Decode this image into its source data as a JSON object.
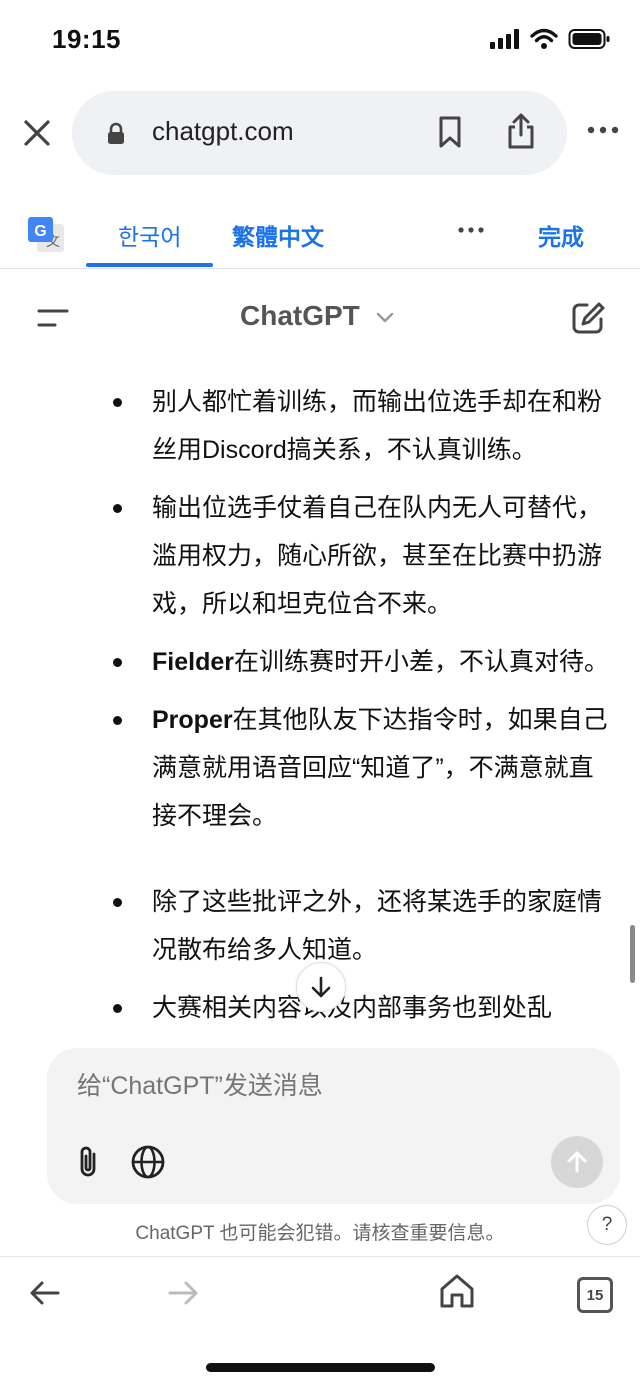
{
  "status_bar": {
    "time": "19:15"
  },
  "address_bar": {
    "url": "chatgpt.com"
  },
  "translate_bar": {
    "languages": [
      "한국어",
      "繁體中文"
    ],
    "done_label": "完成"
  },
  "chat_header": {
    "title": "ChatGPT"
  },
  "messages": [
    {
      "bold": "",
      "text": "别人都忙着训练，而输出位选手却在和粉丝用Discord搞关系，不认真训练。"
    },
    {
      "bold": "",
      "text": "输出位选手仗着自己在队内无人可替代，滥用权力，随心所欲，甚至在比赛中扔游戏，所以和坦克位合不来。"
    },
    {
      "bold": "Fielder",
      "text": "在训练赛时开小差，不认真对待。"
    },
    {
      "bold": "Proper",
      "text": "在其他队友下达指令时，如果自己满意就用语音回应“知道了”，不满意就直接不理会。"
    },
    {
      "bold": "",
      "text": "除了这些批评之外，还将某选手的家庭情况散布给多人知道。"
    },
    {
      "bold": "",
      "text": "大赛相关内容以及内部事务也到处乱"
    }
  ],
  "composer": {
    "placeholder": "给“ChatGPT”发送消息"
  },
  "disclaimer": "ChatGPT 也可能会犯错。请核查重要信息。",
  "help_label": "?",
  "toolbar": {
    "tab_count": "15"
  }
}
